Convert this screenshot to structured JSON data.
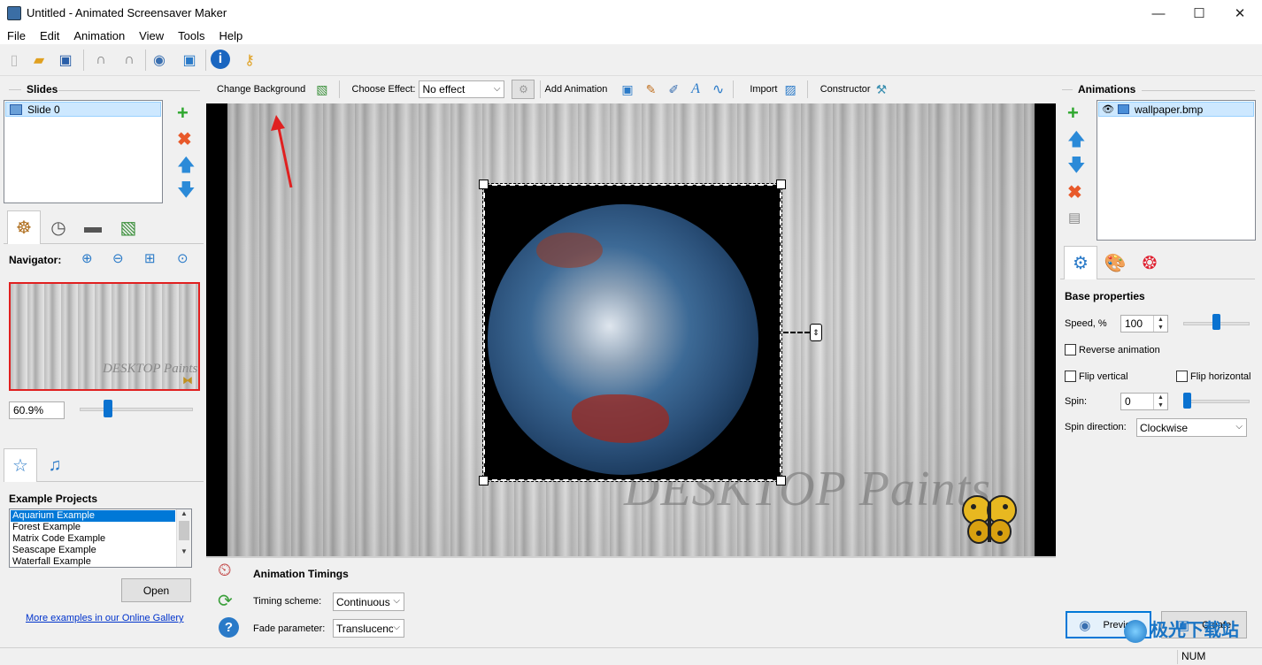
{
  "window": {
    "title": "Untitled - Animated Screensaver Maker",
    "minimize": "—",
    "maximize": "☐",
    "close": "✕"
  },
  "menu": [
    "File",
    "Edit",
    "Animation",
    "View",
    "Tools",
    "Help"
  ],
  "toolbar": {
    "change_background": "Change Background",
    "choose_effect_label": "Choose Effect:",
    "effect_value": "No effect",
    "add_animation": "Add Animation",
    "import": "Import",
    "constructor": "Constructor"
  },
  "slides": {
    "header": "Slides",
    "items": [
      "Slide 0"
    ]
  },
  "navigator": {
    "label": "Navigator:",
    "zoom_value": "60.9%",
    "zoom_slider_fraction": 0.23
  },
  "examples": {
    "header": "Example Projects",
    "items": [
      "Aquarium Example",
      "Forest Example",
      "Matrix Code Example",
      "Seascape Example",
      "Waterfall Example"
    ],
    "open_button": "Open",
    "gallery_link": "More examples in our Online Gallery"
  },
  "canvas": {
    "logo_text": "DESKTOP Paints"
  },
  "timings": {
    "header": "Animation Timings",
    "scheme_label": "Timing scheme:",
    "scheme_value": "Continuous",
    "fade_label": "Fade parameter:",
    "fade_value": "Translucenc"
  },
  "animations": {
    "header": "Animations",
    "items": [
      "wallpaper.bmp"
    ]
  },
  "properties": {
    "header": "Base properties",
    "speed_label": "Speed, %",
    "speed_value": "100",
    "speed_slider_fraction": 0.5,
    "reverse_label": "Reverse animation",
    "flip_vertical_label": "Flip vertical",
    "flip_horizontal_label": "Flip horizontal",
    "spin_label": "Spin:",
    "spin_value": "0",
    "spin_slider_fraction": 0.0,
    "spin_direction_label": "Spin direction:",
    "spin_direction_value": "Clockwise"
  },
  "actions": {
    "preview": "Preview",
    "create": "Create"
  },
  "status": {
    "num": "NUM"
  },
  "watermark_text": "极光下载站"
}
